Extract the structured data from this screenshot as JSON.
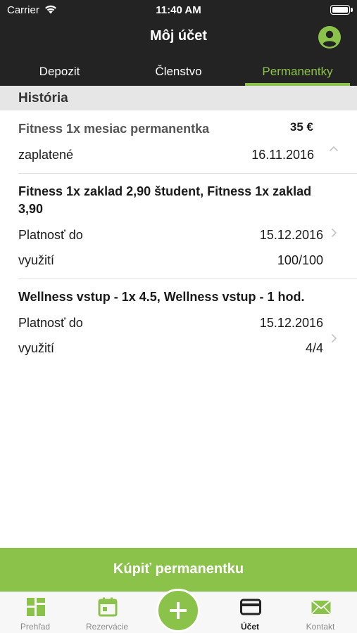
{
  "status_bar": {
    "carrier": "Carrier",
    "time": "11:40 AM"
  },
  "header": {
    "title": "Môj účet",
    "account_icon": "account-circle-icon"
  },
  "tabs": [
    {
      "label": "Depozit",
      "active": false
    },
    {
      "label": "Členstvo",
      "active": false
    },
    {
      "label": "Permanentky",
      "active": true
    }
  ],
  "section": {
    "title": "História"
  },
  "items": [
    {
      "title": "Fitness 1x mesiac permanentka",
      "price": "35 €",
      "expanded": true,
      "rows": [
        {
          "label": "zaplatené",
          "value": "16.11.2016"
        }
      ]
    },
    {
      "title": "Fitness 1x zaklad 2,90 študent, Fitness 1x zaklad 3,90",
      "rows": [
        {
          "label": "Platnosť do",
          "value": "15.12.2016"
        },
        {
          "label": "využití",
          "value": "100/100"
        }
      ]
    },
    {
      "title": "Wellness vstup - 1x 4.5, Wellness vstup - 1 hod.",
      "rows": [
        {
          "label": "Platnosť do",
          "value": "15.12.2016"
        },
        {
          "label": "využití",
          "value": "4/4"
        }
      ]
    }
  ],
  "buy_button": {
    "label": "Kúpiť permanentku"
  },
  "tab_bar": [
    {
      "label": "Prehľad",
      "icon": "dashboard-icon"
    },
    {
      "label": "Rezervácie",
      "icon": "calendar-icon"
    },
    {
      "label": "Účet",
      "icon": "credit-card-icon",
      "active": true
    },
    {
      "label": "Kontakt",
      "icon": "envelope-icon"
    }
  ],
  "colors": {
    "accent": "#8bc34a",
    "header_bg": "#232323",
    "section_bg": "#e6e6e6"
  }
}
